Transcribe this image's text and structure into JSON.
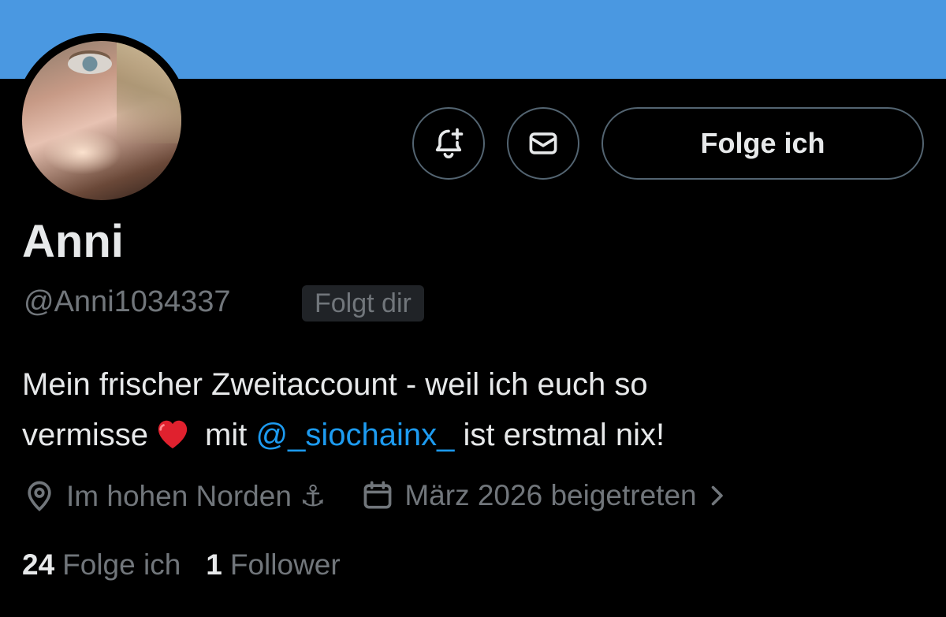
{
  "profile": {
    "display_name": "Anni",
    "handle": "@Anni1034337",
    "follows_you_badge": "Folgt dir",
    "bio_part1": "Mein frischer Zweitaccount - weil ich euch so",
    "bio_part2": "vermisse",
    "bio_part3": "mit",
    "bio_mention": "@_siochainx_",
    "bio_part4": "ist erstmal nix!",
    "location": "Im hohen Norden ⚓",
    "joined": "März 2026 beigetreten",
    "following_count": "24",
    "following_label": "Folge ich",
    "followers_count": "1",
    "followers_label": "Follower"
  },
  "actions": {
    "follow_button_label": "Folge ich",
    "notifications_icon": "bell-plus-icon",
    "message_icon": "envelope-icon"
  },
  "colors": {
    "banner": "#4a98e1",
    "background": "#000000",
    "mention": "#1d9bf0",
    "muted_text": "#71767b"
  }
}
